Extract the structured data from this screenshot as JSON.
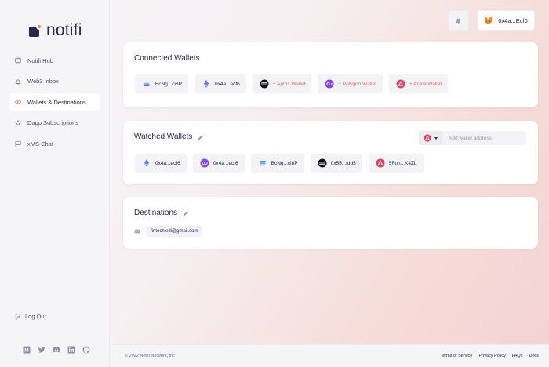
{
  "brand": {
    "name": "notifi"
  },
  "sidebar": {
    "items": [
      {
        "label": "Notifi Hub",
        "icon": "grid-icon"
      },
      {
        "label": "Web3 Inbox",
        "icon": "bell-icon"
      },
      {
        "label": "Wallets & Destinations",
        "icon": "link-icon",
        "active": true
      },
      {
        "label": "Dapp Subscriptions",
        "icon": "star-icon"
      },
      {
        "label": "xMS Chat",
        "icon": "chat-icon"
      }
    ],
    "logout_label": "Log Out",
    "socials": [
      "medium-icon",
      "twitter-icon",
      "discord-icon",
      "linkedin-icon",
      "github-icon"
    ]
  },
  "header": {
    "bell_icon": "bell-icon",
    "wallet_label": "0x4a...Ecf6",
    "wallet_icon": "metamask-fox-icon"
  },
  "connected": {
    "title": "Connected Wallets",
    "wallets": [
      {
        "label": "BcNg...ci8P",
        "icon": "solana-icon"
      },
      {
        "label": "0x4a...ecf6",
        "icon": "ethereum-icon"
      }
    ],
    "add_buttons": [
      {
        "label": "+ Aptos Wallet",
        "icon": "aptos-icon"
      },
      {
        "label": "+ Polygon Wallet",
        "icon": "polygon-icon"
      },
      {
        "label": "+ Acala Wallet",
        "icon": "acala-icon"
      }
    ]
  },
  "watched": {
    "title": "Watched Wallets",
    "input_placeholder": "Add wallet address",
    "network_icon": "acala-icon",
    "wallets": [
      {
        "label": "0x4a...ecf6",
        "icon": "ethereum-icon"
      },
      {
        "label": "0x4a...ecf6",
        "icon": "polygon-icon"
      },
      {
        "label": "BcNg...ci8P",
        "icon": "solana-icon"
      },
      {
        "label": "0x55...fdd5",
        "icon": "aptos-icon"
      },
      {
        "label": "5Fuh...K4ZL",
        "icon": "acala-icon"
      }
    ]
  },
  "destinations": {
    "title": "Destinations",
    "email": "fintechjedi@gmail.com",
    "email_icon": "mail-icon"
  },
  "footer": {
    "copyright": "© 2022 Notifi Network, Inc",
    "links": [
      "Terms of Service",
      "Privacy Policy",
      "FAQs",
      "Docs"
    ]
  },
  "colors": {
    "accent": "#f27c5b",
    "text": "#262949",
    "polygon": "#8247e5",
    "acala": "#e4405f"
  }
}
